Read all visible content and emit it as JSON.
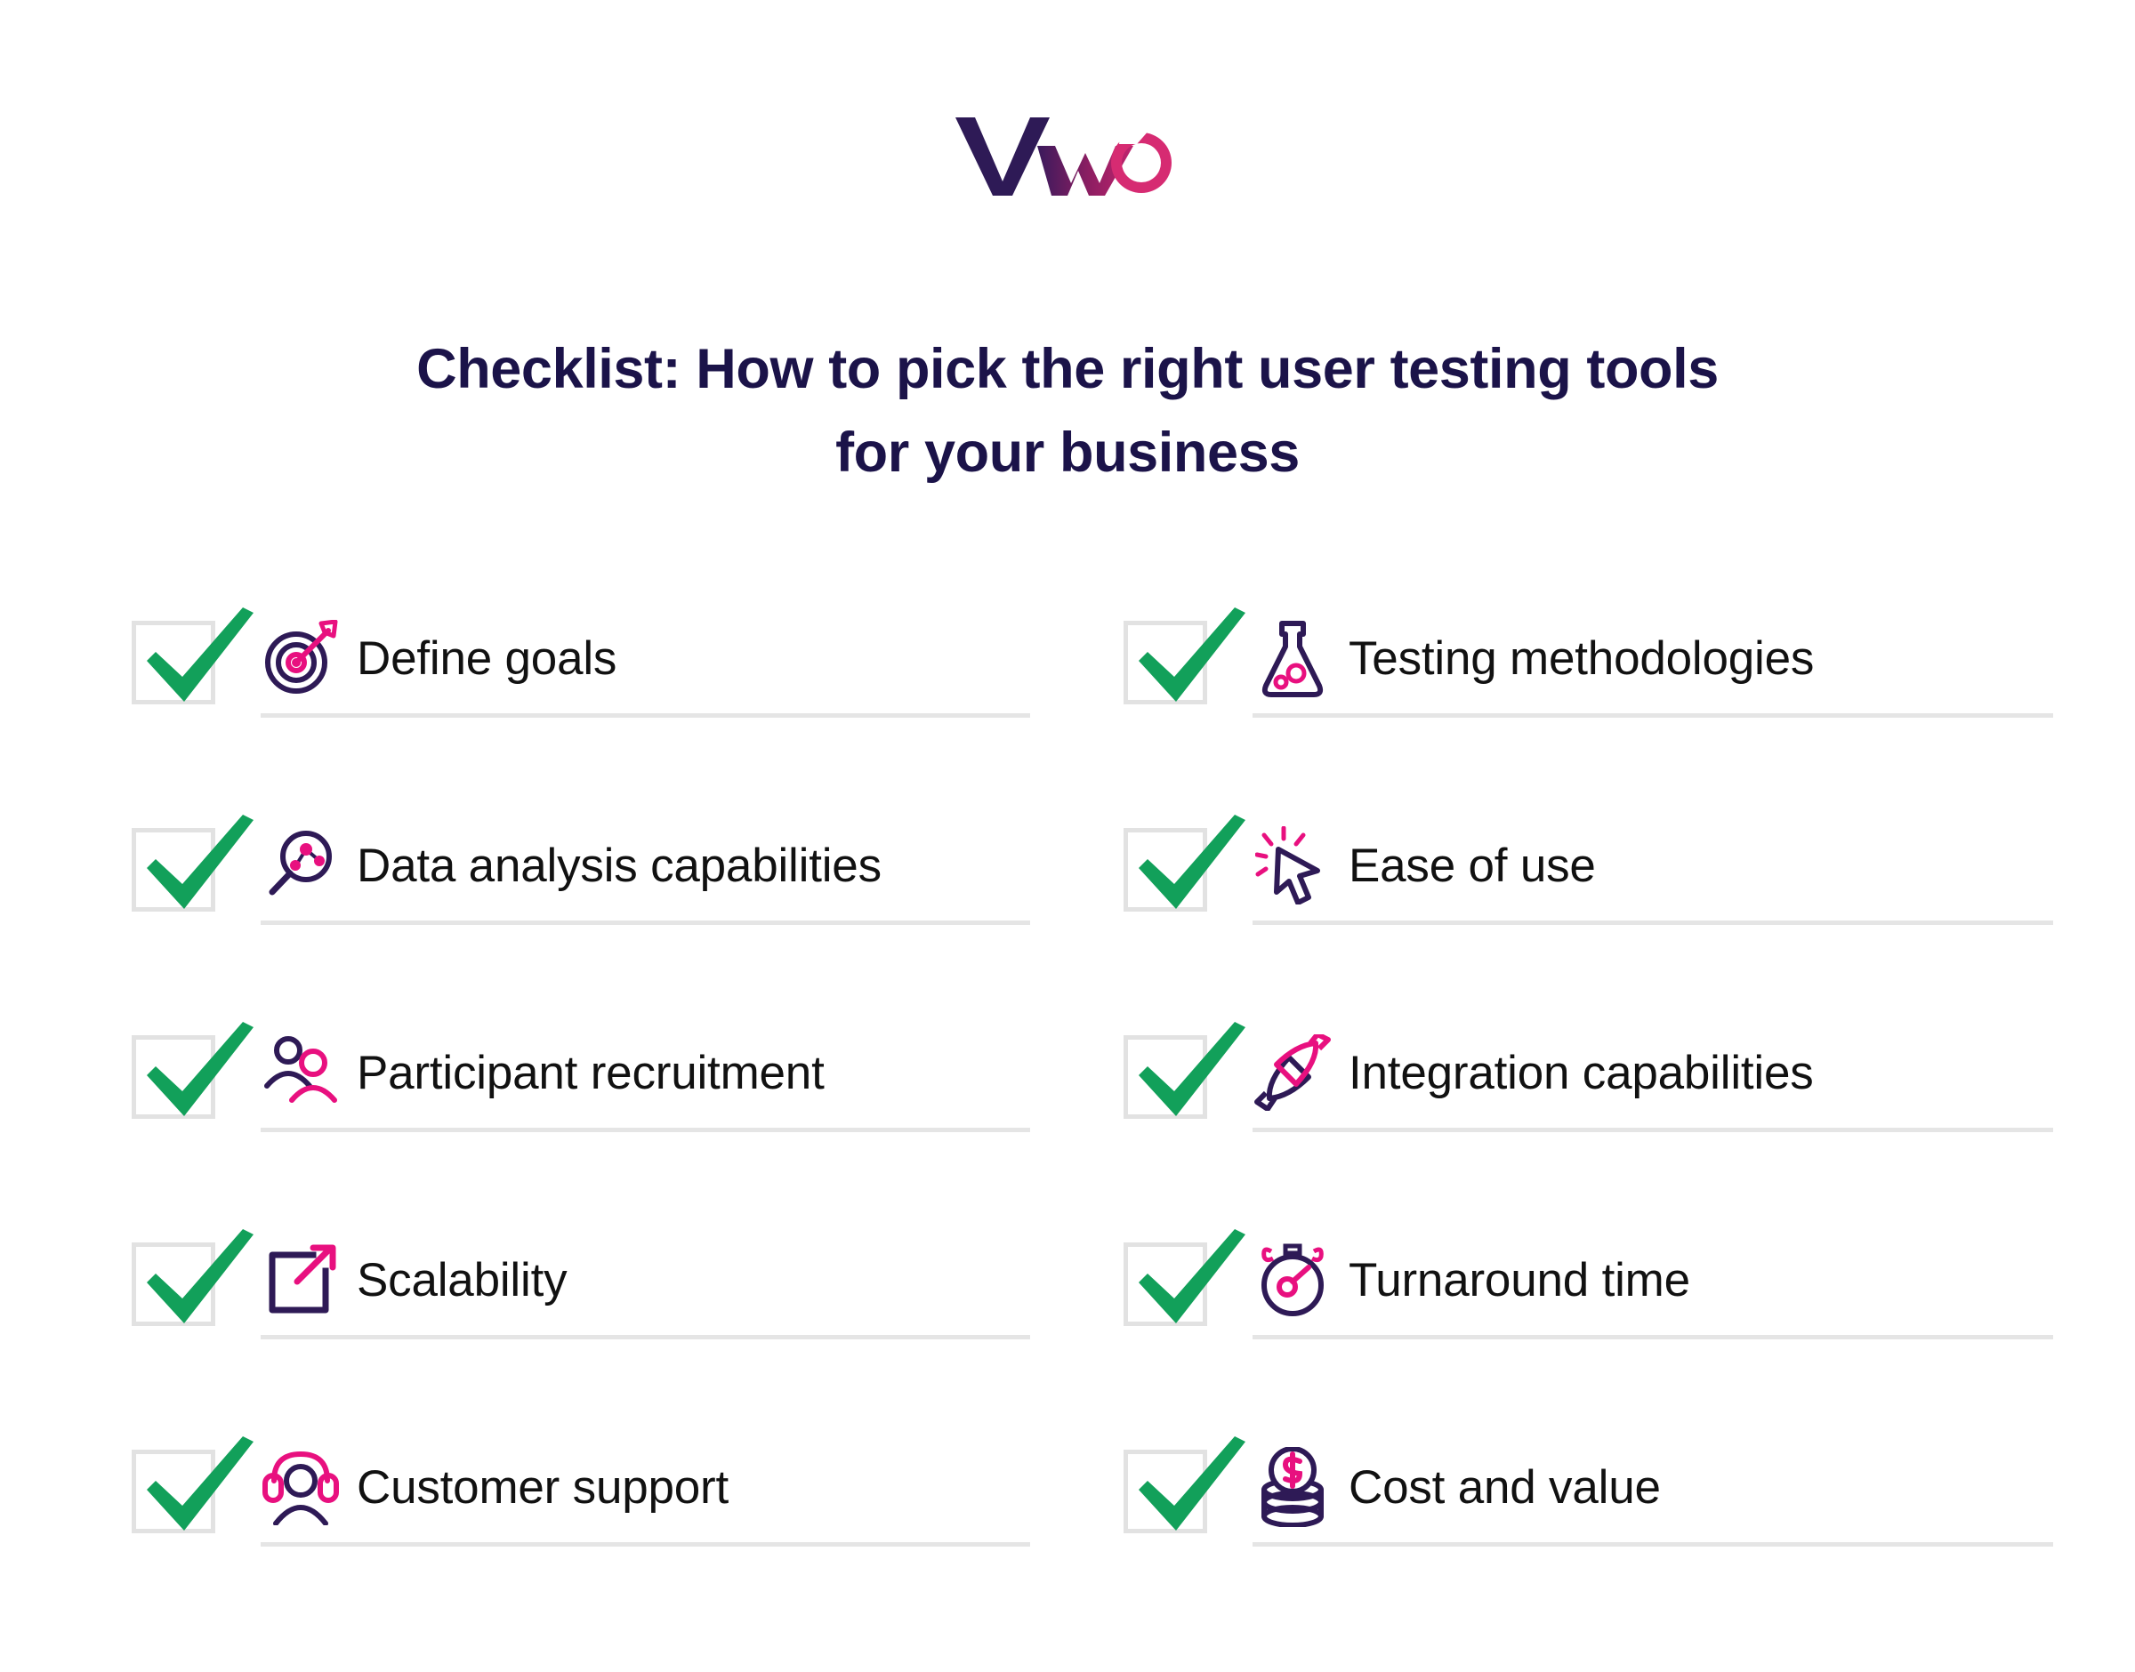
{
  "brand": {
    "logo_name": "vwo-logo",
    "logo_text": "VWO",
    "color_purple": "#2e1a56",
    "color_magenta": "#d62b72",
    "color_pink": "#e8107f"
  },
  "colors": {
    "title": "#1b1349",
    "label": "#111111",
    "check_green": "#12a05a",
    "checkbox_border": "#e2e2e2",
    "rule": "#e5e5e5",
    "icon_purple": "#2e1a56",
    "icon_magenta": "#e8107f",
    "background": "#ffffff"
  },
  "header": {
    "title_line1": "Checklist: How to pick the right user testing tools",
    "title_line2": "for your business"
  },
  "checklist": {
    "left_column": [
      {
        "label": "Define goals",
        "icon": "target-arrow-icon",
        "checked": true
      },
      {
        "label": "Data analysis capabilities",
        "icon": "magnifier-data-icon",
        "checked": true
      },
      {
        "label": "Participant recruitment",
        "icon": "two-people-icon",
        "checked": true
      },
      {
        "label": "Scalability",
        "icon": "expand-arrow-square-icon",
        "checked": true
      },
      {
        "label": "Customer support",
        "icon": "headset-person-icon",
        "checked": true
      }
    ],
    "right_column": [
      {
        "label": "Testing methodologies",
        "icon": "flask-icon",
        "checked": true
      },
      {
        "label": "Ease of use",
        "icon": "cursor-click-icon",
        "checked": true
      },
      {
        "label": "Integration capabilities",
        "icon": "plug-connect-icon",
        "checked": true
      },
      {
        "label": "Turnaround time",
        "icon": "stopwatch-icon",
        "checked": true
      },
      {
        "label": "Cost and value",
        "icon": "coin-stack-dollar-icon",
        "checked": true
      }
    ]
  }
}
